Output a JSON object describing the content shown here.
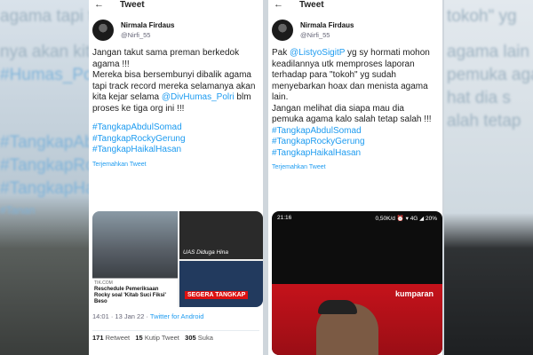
{
  "background": {
    "left_fragments": [
      "agama tapi track",
      "nya akan kita",
      "#Humas_Poli",
      "#TangkapAbdulS",
      "#TangkapRocky",
      "#TangkapHaikal",
      "#Tanan"
    ],
    "right_fragments": [
      "tokoh\" yg",
      "agama lain",
      "pemuka agama",
      "hat dia s",
      "alah tetap"
    ]
  },
  "tweet1": {
    "header_title": "Tweet",
    "user_name": "Nirmala Firdaus",
    "user_handle": "@Nirfi_55",
    "line1": "Jangan takut sama preman berkedok agama !!!",
    "line2_pre": "Mereka bisa bersembunyi dibalik agama tapi track record mereka selamanya akan kita kejar selama ",
    "line2_link": "@DivHumas_Polri",
    "line2_post": " blm proses ke tiga org ini !!!",
    "hashtags": [
      "#TangkapAbdulSomad",
      "#TangkapRockyGerung",
      "#TangkapHaikalHasan"
    ],
    "translate": "Terjemahkan Tweet",
    "media": {
      "site": "TIK.COM",
      "headline": "Reschedule Pemeriksaan Rocky soal 'Kitab Suci Fiksi' Beso",
      "caption2": "UAS Diduga Hina",
      "caption3": "SEGERA TANGKAP"
    },
    "meta_time": "14:01 · 13 Jan 22 · ",
    "meta_source": "Twitter for Android",
    "stats": {
      "retweets": "171",
      "retweets_label": "Retweet",
      "quotes": "15",
      "quotes_label": "Kutip Tweet",
      "likes": "305",
      "likes_label": "Suka"
    }
  },
  "tweet2": {
    "header_title": "Tweet",
    "user_name": "Nirmala Firdaus",
    "user_handle": "@Nirfi_55",
    "line1_pre": "Pak ",
    "line1_link": "@ListyoSigitP",
    "line1_post": " yg sy hormati mohon keadilannya utk memproses laporan terhadap para \"tokoh\" yg sudah menyebarkan hoax dan menista agama lain.",
    "line2": "Jangan melihat dia siapa mau dia pemuka agama kalo salah tetap salah !!!",
    "hashtags": [
      "#TangkapAbdulSomad",
      "#TangkapRockyGerung",
      "#TangkapHaikalHasan"
    ],
    "translate": "Terjemahkan Tweet",
    "phone": {
      "time": "21:16",
      "status": "0,50K/d ⏰ ▾ 4G ◢ 20%",
      "brand": "kumparan"
    }
  }
}
